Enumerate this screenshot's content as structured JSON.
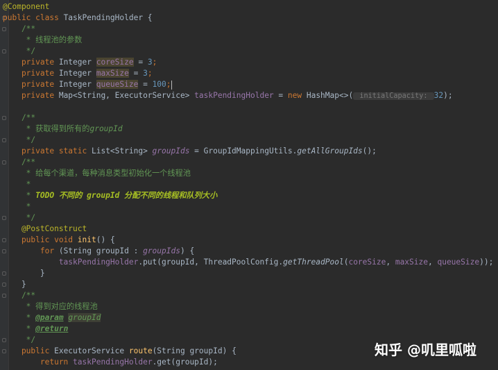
{
  "lines": [
    {
      "tokens": [
        {
          "t": "@Component",
          "c": "ann"
        }
      ]
    },
    {
      "tokens": [
        {
          "t": "public class ",
          "c": "kw"
        },
        {
          "t": "TaskPendingHolder {",
          "c": ""
        }
      ]
    },
    {
      "tokens": [
        {
          "t": "    /**",
          "c": "cm"
        }
      ]
    },
    {
      "tokens": [
        {
          "t": "     * 线程池的参数",
          "c": "cm"
        }
      ]
    },
    {
      "tokens": [
        {
          "t": "     */",
          "c": "cm"
        }
      ]
    },
    {
      "tokens": [
        {
          "t": "    private ",
          "c": "kw"
        },
        {
          "t": "Integer ",
          "c": ""
        },
        {
          "t": "coreSize",
          "c": "fld hl"
        },
        {
          "t": " = ",
          "c": ""
        },
        {
          "t": "3",
          "c": "num"
        },
        {
          "t": ";",
          "c": "kw"
        }
      ]
    },
    {
      "tokens": [
        {
          "t": "    private ",
          "c": "kw"
        },
        {
          "t": "Integer ",
          "c": ""
        },
        {
          "t": "maxSize",
          "c": "fld hl"
        },
        {
          "t": " = ",
          "c": ""
        },
        {
          "t": "3",
          "c": "num"
        },
        {
          "t": ";",
          "c": "kw"
        }
      ]
    },
    {
      "tokens": [
        {
          "t": "    private ",
          "c": "kw"
        },
        {
          "t": "Integer ",
          "c": ""
        },
        {
          "t": "queueSize",
          "c": "fld hl"
        },
        {
          "t": " = ",
          "c": ""
        },
        {
          "t": "100",
          "c": "num"
        },
        {
          "t": ";",
          "c": "kw"
        },
        {
          "t": "",
          "c": "caret"
        }
      ]
    },
    {
      "tokens": [
        {
          "t": "    private ",
          "c": "kw"
        },
        {
          "t": "Map<String, ExecutorService> ",
          "c": ""
        },
        {
          "t": "taskPendingHolder",
          "c": "fld"
        },
        {
          "t": " = ",
          "c": ""
        },
        {
          "t": "new ",
          "c": "kw"
        },
        {
          "t": "HashMap<>(",
          "c": ""
        },
        {
          "t": " initialCapacity: ",
          "c": "hint"
        },
        {
          "t": "32",
          "c": "num"
        },
        {
          "t": ");",
          "c": ""
        }
      ]
    },
    {
      "tokens": []
    },
    {
      "tokens": [
        {
          "t": "    /**",
          "c": "cm"
        }
      ]
    },
    {
      "tokens": [
        {
          "t": "     * 获取得到所有的",
          "c": "cm"
        },
        {
          "t": "groupId",
          "c": "cmi"
        }
      ]
    },
    {
      "tokens": [
        {
          "t": "     */",
          "c": "cm"
        }
      ]
    },
    {
      "tokens": [
        {
          "t": "    private static ",
          "c": "kw"
        },
        {
          "t": "List<String> ",
          "c": ""
        },
        {
          "t": "groupIds",
          "c": "fldi"
        },
        {
          "t": " = GroupIdMappingUtils.",
          "c": ""
        },
        {
          "t": "getAllGroupIds",
          "c": "it"
        },
        {
          "t": "();",
          "c": ""
        }
      ]
    },
    {
      "tokens": [
        {
          "t": "    /**",
          "c": "cm"
        }
      ]
    },
    {
      "tokens": [
        {
          "t": "     * 给每个渠道，每种消息类型初始化一个线程池",
          "c": "cm"
        }
      ]
    },
    {
      "tokens": [
        {
          "t": "     *",
          "c": "cm"
        }
      ]
    },
    {
      "tokens": [
        {
          "t": "     * ",
          "c": "cm"
        },
        {
          "t": "TODO 不同的 groupId 分配不同的线程和队列大小",
          "c": "todo"
        }
      ]
    },
    {
      "tokens": [
        {
          "t": "     *",
          "c": "cm"
        }
      ]
    },
    {
      "tokens": [
        {
          "t": "     */",
          "c": "cm"
        }
      ]
    },
    {
      "tokens": [
        {
          "t": "    @PostConstruct",
          "c": "ann"
        }
      ]
    },
    {
      "tokens": [
        {
          "t": "    public void ",
          "c": "kw"
        },
        {
          "t": "init",
          "c": "fn"
        },
        {
          "t": "() {",
          "c": ""
        }
      ]
    },
    {
      "tokens": [
        {
          "t": "        for ",
          "c": "kw"
        },
        {
          "t": "(String groupId : ",
          "c": ""
        },
        {
          "t": "groupIds",
          "c": "fldi"
        },
        {
          "t": ") {",
          "c": ""
        }
      ]
    },
    {
      "tokens": [
        {
          "t": "            taskPendingHolder",
          "c": "fld"
        },
        {
          "t": ".put(groupId, ThreadPoolConfig.",
          "c": ""
        },
        {
          "t": "getThreadPool",
          "c": "it"
        },
        {
          "t": "(",
          "c": ""
        },
        {
          "t": "coreSize",
          "c": "fld"
        },
        {
          "t": ", ",
          "c": ""
        },
        {
          "t": "maxSize",
          "c": "fld"
        },
        {
          "t": ", ",
          "c": ""
        },
        {
          "t": "queueSize",
          "c": "fld"
        },
        {
          "t": "));",
          "c": ""
        }
      ]
    },
    {
      "tokens": [
        {
          "t": "        }",
          "c": ""
        }
      ]
    },
    {
      "tokens": [
        {
          "t": "    }",
          "c": ""
        }
      ]
    },
    {
      "tokens": [
        {
          "t": "    /**",
          "c": "cm"
        }
      ]
    },
    {
      "tokens": [
        {
          "t": "     * 得到对应的线程池",
          "c": "cm"
        }
      ]
    },
    {
      "tokens": [
        {
          "t": "     * ",
          "c": "cm"
        },
        {
          "t": "@param",
          "c": "cmtag"
        },
        {
          "t": " ",
          "c": "cm"
        },
        {
          "t": "groupId",
          "c": "cmi hlu"
        }
      ]
    },
    {
      "tokens": [
        {
          "t": "     * ",
          "c": "cm"
        },
        {
          "t": "@return",
          "c": "cmtag"
        }
      ]
    },
    {
      "tokens": [
        {
          "t": "     */",
          "c": "cm"
        }
      ]
    },
    {
      "tokens": [
        {
          "t": "    public ",
          "c": "kw"
        },
        {
          "t": "ExecutorService ",
          "c": ""
        },
        {
          "t": "route",
          "c": "fn"
        },
        {
          "t": "(String groupId) {",
          "c": ""
        }
      ]
    },
    {
      "tokens": [
        {
          "t": "        return ",
          "c": "kw"
        },
        {
          "t": "taskPendingHolder",
          "c": "fld"
        },
        {
          "t": ".get(groupId);",
          "c": ""
        }
      ]
    }
  ],
  "watermark": "知乎 @叽里呱啦"
}
